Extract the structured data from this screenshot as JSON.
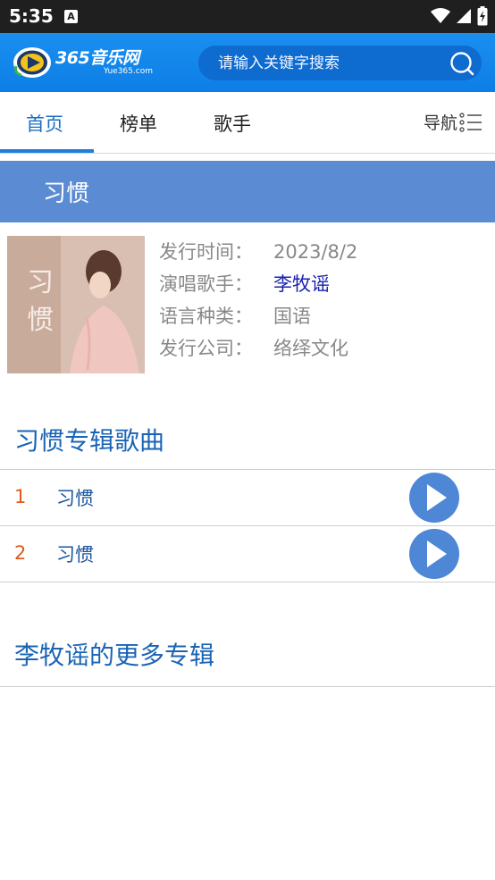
{
  "status_bar": {
    "time": "5:35",
    "notification_icon": "A"
  },
  "header": {
    "logo_text": "365音乐网",
    "logo_sub": "Yue365.com",
    "search_placeholder": "请输入关键字搜索"
  },
  "tabs": [
    {
      "label": "首页",
      "active": true
    },
    {
      "label": "榜单",
      "active": false
    },
    {
      "label": "歌手",
      "active": false
    }
  ],
  "nav_label": "导航",
  "album": {
    "title": "习惯",
    "info": [
      {
        "key": "发行时间：",
        "value": "2023/8/2"
      },
      {
        "key": "演唱歌手：",
        "value": "李牧谣"
      },
      {
        "key": "语言种类：",
        "value": "国语"
      },
      {
        "key": "发行公司：",
        "value": "络绎文化"
      }
    ]
  },
  "songs_section": {
    "title": "习惯专辑歌曲",
    "songs": [
      {
        "num": "1",
        "name": "习惯"
      },
      {
        "num": "2",
        "name": "习惯"
      }
    ]
  },
  "more_section": {
    "title": "李牧谣的更多专辑"
  },
  "colors": {
    "header_blue": "#1a8ff0",
    "title_bar": "#5b8bd3",
    "track_number": "#e05a1a",
    "link": "#1a21b0"
  }
}
